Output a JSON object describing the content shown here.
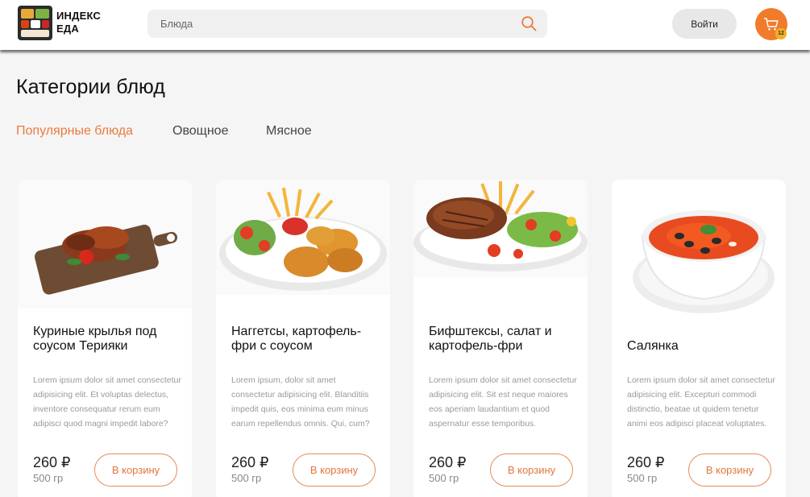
{
  "header": {
    "logo_line1": "ИНДЕКС",
    "logo_line2": "ЕДА",
    "search_placeholder": "Блюда",
    "login_label": "Войти",
    "cart_count": "12"
  },
  "main": {
    "title": "Категории блюд",
    "tabs": [
      {
        "label": "Популярные блюда",
        "active": true
      },
      {
        "label": "Овощное",
        "active": false
      },
      {
        "label": "Мясное",
        "active": false
      }
    ],
    "cards": [
      {
        "title": "Куриные крылья под соусом Терияки",
        "description": "Lorem ipsum dolor sit amet consectetur adipisicing elit. Et voluptas delectus, inventore consequatur rerum eum adipisci quod magni impedit labore?",
        "price": "260 ₽",
        "weight": "500 гр",
        "button": "В корзину",
        "image": "chicken-wings-image"
      },
      {
        "title": "Наггетсы, картофель-фри с соусом",
        "description": "Lorem ipsum, dolor sit amet consectetur adipisicing elit. Blanditiis impedit quis, eos minima eum minus earum repellendus omnis. Qui, cum?",
        "price": "260 ₽",
        "weight": "500 гр",
        "button": "В корзину",
        "image": "nuggets-image"
      },
      {
        "title": "Бифштексы, салат и картофель-фри",
        "description": "Lorem ipsum dolor sit amet consectetur adipisicing elit. Sit est neque maiores eos aperiam laudantium et quod aspernatur esse temporibus.",
        "price": "260 ₽",
        "weight": "500 гр",
        "button": "В корзину",
        "image": "steak-image"
      },
      {
        "title": "Салянка",
        "description": "Lorem ipsum dolor sit amet consectetur adipisicing elit. Excepturi commodi distinctio, beatae ut quidem tenetur animi eos adipisci placeat voluptates.",
        "price": "260 ₽",
        "weight": "500 гр",
        "button": "В корзину",
        "image": "soup-image"
      }
    ]
  },
  "colors": {
    "accent": "#f07b2b",
    "tab_active": "#ea7a3d",
    "button_border": "#e58a57",
    "badge": "#f5b021"
  }
}
